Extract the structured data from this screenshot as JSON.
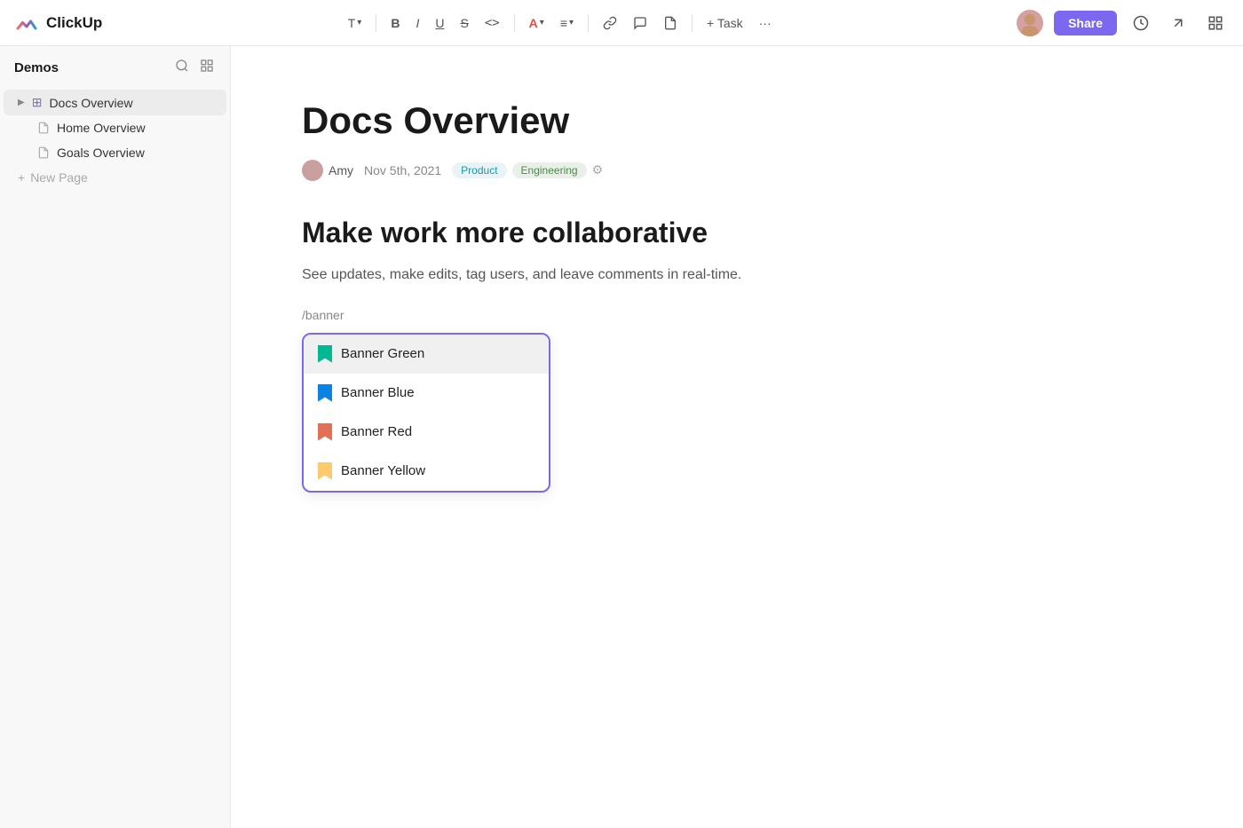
{
  "app": {
    "name": "ClickUp"
  },
  "toolbar": {
    "text_label": "T",
    "bold": "B",
    "italic": "I",
    "underline": "U",
    "strikethrough": "S",
    "code": "<>",
    "font_color": "A",
    "align": "≡",
    "link": "🔗",
    "comment": "💬",
    "attach": "📄",
    "add_task": "+ Task",
    "more": "···",
    "share_label": "Share",
    "history_icon": "🕐",
    "export_icon": "↗",
    "view_icon": "⬜"
  },
  "sidebar": {
    "title": "Demos",
    "search_icon": "🔍",
    "layout_icon": "⊞",
    "items": [
      {
        "id": "docs-overview",
        "label": "Docs Overview",
        "type": "grid",
        "active": true
      },
      {
        "id": "home-overview",
        "label": "Home Overview",
        "type": "doc"
      },
      {
        "id": "goals-overview",
        "label": "Goals Overview",
        "type": "doc"
      }
    ],
    "new_page_label": "New Page",
    "new_page_icon": "+"
  },
  "document": {
    "title": "Docs Overview",
    "author": "Amy",
    "date": "Nov 5th, 2021",
    "tags": [
      {
        "label": "Product",
        "class": "product"
      },
      {
        "label": "Engineering",
        "class": "engineering"
      }
    ],
    "section_heading": "Make work more collaborative",
    "section_text": "See updates, make edits, tag users, and leave comments in real-time.",
    "slash_command": "/banner"
  },
  "dropdown": {
    "items": [
      {
        "id": "banner-green",
        "label": "Banner Green",
        "color": "green",
        "highlighted": true
      },
      {
        "id": "banner-blue",
        "label": "Banner Blue",
        "color": "blue",
        "highlighted": false
      },
      {
        "id": "banner-red",
        "label": "Banner Red",
        "color": "red",
        "highlighted": false
      },
      {
        "id": "banner-yellow",
        "label": "Banner Yellow",
        "color": "yellow",
        "highlighted": false
      }
    ]
  }
}
